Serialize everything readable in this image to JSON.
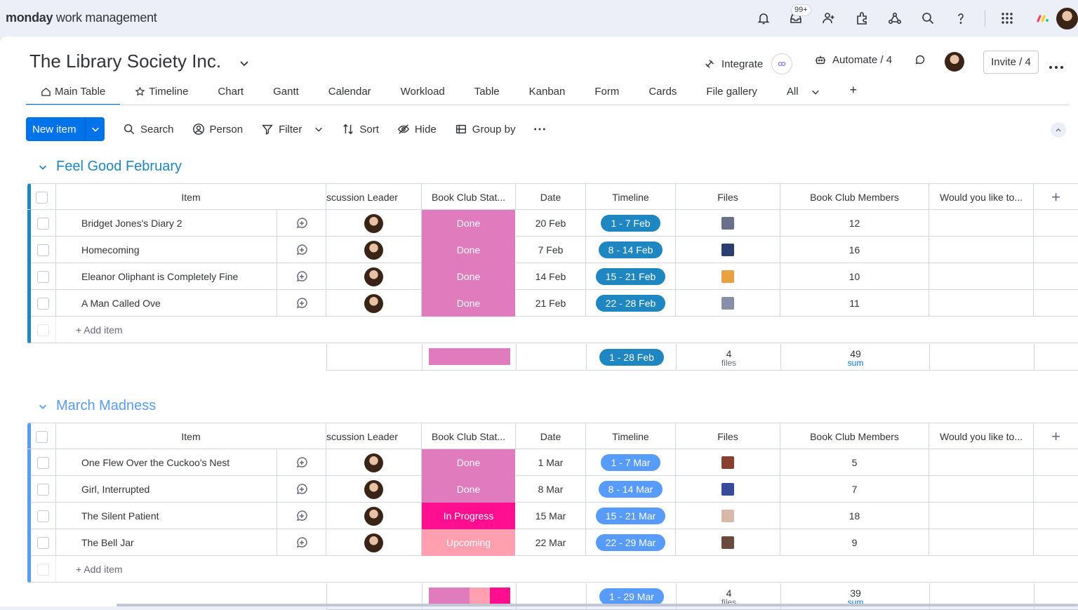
{
  "app": {
    "brand_bold": "monday",
    "brand_rest": " work management",
    "notif_badge": "99+"
  },
  "board": {
    "title": "The Library Society Inc.",
    "integrate_label": "Integrate",
    "automate_label": "Automate / 4",
    "invite_label": "Invite / 4"
  },
  "tabs": [
    "Main Table",
    "Timeline",
    "Chart",
    "Gantt",
    "Calendar",
    "Workload",
    "Table",
    "Kanban",
    "Form",
    "Cards",
    "File gallery",
    "All"
  ],
  "toolbar": {
    "new_item": "New item",
    "search": "Search",
    "person": "Person",
    "filter": "Filter",
    "sort": "Sort",
    "hide": "Hide",
    "group_by": "Group by"
  },
  "columns": [
    "Item",
    "scussion Leader",
    "Book Club Stat...",
    "Date",
    "Timeline",
    "Files",
    "Book Club Members",
    "Would you like to..."
  ],
  "colors": {
    "primary": "#0073ea",
    "done": "#e07bbd",
    "in_progress": "#ff0f8f",
    "upcoming": "#ff9fb0",
    "group1": "#1e86c0",
    "group2": "#579bfc",
    "timeline1": "#1e86c0",
    "timeline2": "#579bfc"
  },
  "groups": [
    {
      "title": "Feel Good February",
      "add_item": "+ Add item",
      "items": [
        {
          "name": "Bridget Jones's Diary 2",
          "status": "Done",
          "date": "20 Feb",
          "timeline": "1 - 7 Feb",
          "members": "12"
        },
        {
          "name": "Homecoming",
          "status": "Done",
          "date": "7 Feb",
          "timeline": "8 - 14 Feb",
          "members": "16"
        },
        {
          "name": "Eleanor Oliphant is Completely Fine",
          "status": "Done",
          "date": "14 Feb",
          "timeline": "15 - 21 Feb",
          "members": "10"
        },
        {
          "name": "A Man Called Ove",
          "status": "Done",
          "date": "21 Feb",
          "timeline": "22 - 28 Feb",
          "members": "11"
        }
      ],
      "summary": {
        "timeline": "1 - 28 Feb",
        "files_count": "4",
        "files_label": "files",
        "members_sum": "49",
        "sum_label": "sum"
      }
    },
    {
      "title": "March Madness",
      "add_item": "+ Add item",
      "items": [
        {
          "name": "One Flew Over the Cuckoo's Nest",
          "status": "Done",
          "date": "1 Mar",
          "timeline": "1 - 7 Mar",
          "members": "5"
        },
        {
          "name": "Girl, Interrupted",
          "status": "Done",
          "date": "8 Mar",
          "timeline": "8 - 14 Mar",
          "members": "7"
        },
        {
          "name": "The Silent Patient",
          "status": "In Progress",
          "date": "15 Mar",
          "timeline": "15 - 21 Mar",
          "members": "18"
        },
        {
          "name": "The Bell Jar",
          "status": "Upcoming",
          "date": "22 Mar",
          "timeline": "22 - 29 Mar",
          "members": "9"
        }
      ],
      "summary": {
        "timeline": "1 - 29 Mar",
        "files_count": "4",
        "files_label": "files",
        "members_sum": "39",
        "sum_label": "sum"
      }
    }
  ]
}
